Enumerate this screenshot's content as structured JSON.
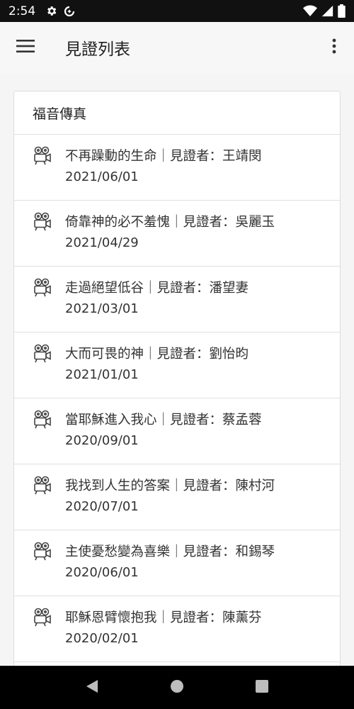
{
  "status_bar": {
    "time": "2:54",
    "icons": [
      "gear-icon",
      "data-saver-icon",
      "wifi-icon",
      "signal-icon",
      "battery-icon"
    ]
  },
  "app_bar": {
    "title": "見證列表",
    "icons": [
      "menu-icon",
      "more-vert-icon"
    ]
  },
  "card": {
    "header": "福音傳真",
    "items": [
      {
        "title": "不再躁動的生命｜見證者：王靖閔",
        "date": "2021/06/01",
        "icon": "film-camera-icon"
      },
      {
        "title": "倚靠神的必不羞愧｜見證者：吳麗玉",
        "date": "2021/04/29",
        "icon": "film-camera-icon"
      },
      {
        "title": "走過絕望低谷｜見證者：潘望妻",
        "date": "2021/03/01",
        "icon": "film-camera-icon"
      },
      {
        "title": "大而可畏的神｜見證者：劉怡昀",
        "date": "2021/01/01",
        "icon": "film-camera-icon"
      },
      {
        "title": "當耶穌進入我心｜見證者：蔡孟蓉",
        "date": "2020/09/01",
        "icon": "film-camera-icon"
      },
      {
        "title": "我找到人生的答案｜見證者：陳村河",
        "date": "2020/07/01",
        "icon": "film-camera-icon"
      },
      {
        "title": "主使憂愁變為喜樂｜見證者：和錫琴",
        "date": "2020/06/01",
        "icon": "film-camera-icon"
      },
      {
        "title": "耶穌恩臂懷抱我｜見證者：陳薰芬",
        "date": "2020/02/01",
        "icon": "film-camera-icon"
      }
    ]
  },
  "nav_bar": {
    "icons": [
      "back-icon",
      "home-icon",
      "recents-icon"
    ]
  },
  "colors": {
    "status_bar_bg": "#111111",
    "app_bar_bg": "#f7f7f7",
    "content_bg": "#f5f5f5",
    "card_bg": "#ffffff",
    "divider": "#e0e0e0",
    "nav_bar_bg": "#000000"
  }
}
